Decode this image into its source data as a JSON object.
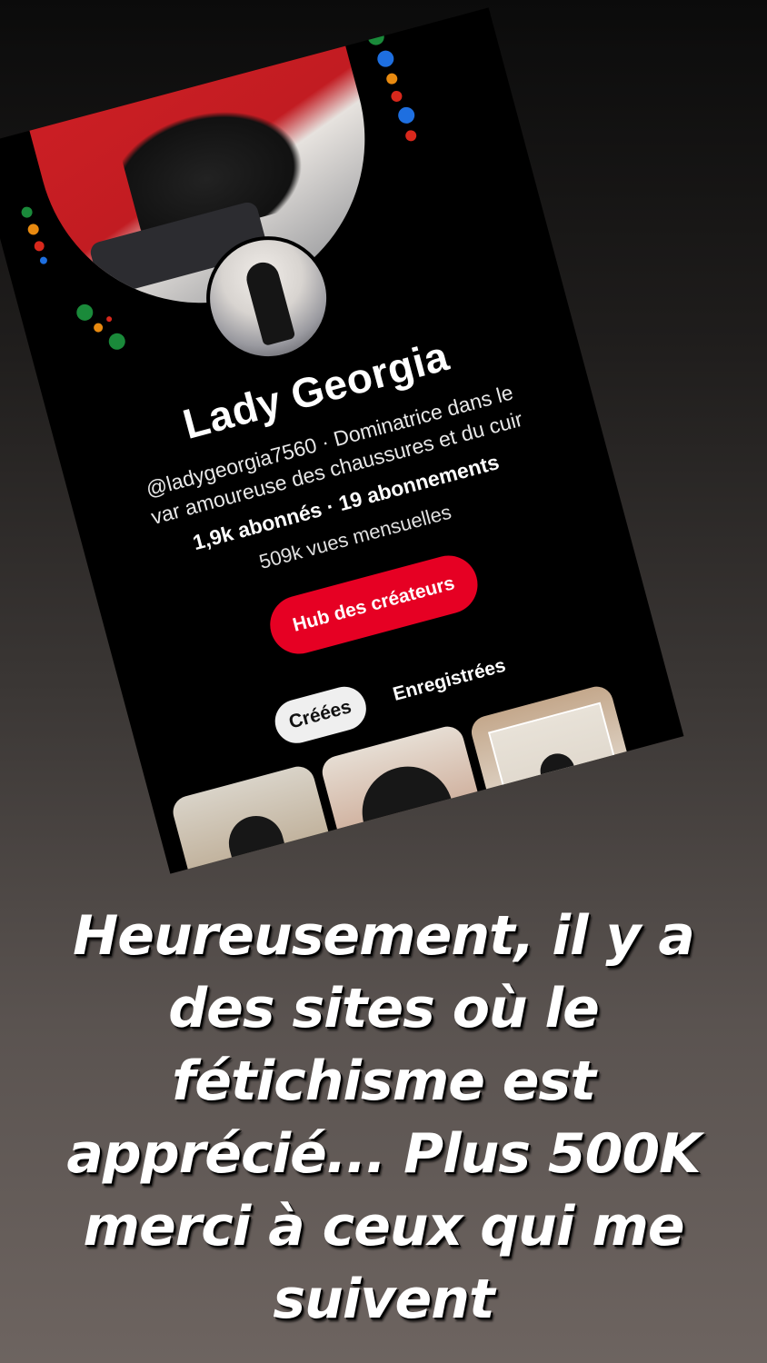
{
  "profile": {
    "name": "Lady Georgia",
    "bio_line1": "@ladygeorgia7560 · Dominatrice dans le",
    "bio_line2": "var amoureuse des chaussures et du cuir",
    "stats": "1,9k abonnés · 19 abonnements",
    "views": "509k vues mensuelles"
  },
  "actions": {
    "hub_button": "Hub des créateurs"
  },
  "tabs": [
    {
      "label": "Créées",
      "active": true
    },
    {
      "label": "Enregistrées",
      "active": false
    }
  ],
  "pins": [
    "pin-photo-1",
    "pin-photo-2",
    "pin-photo-3"
  ],
  "caption": {
    "line1": "Heureusement, il y a",
    "line2": "des sites où le",
    "line3": "fétichisme est",
    "line4": "apprécié... Plus 500K",
    "line5": "merci à ceux qui me",
    "line6": "suivent"
  },
  "colors": {
    "accent": "#e60023",
    "card_background": "#000000",
    "dot_green": "#1a8a3a",
    "dot_blue": "#1e6fe0",
    "dot_orange": "#e88a10",
    "dot_red": "#d8281c"
  }
}
